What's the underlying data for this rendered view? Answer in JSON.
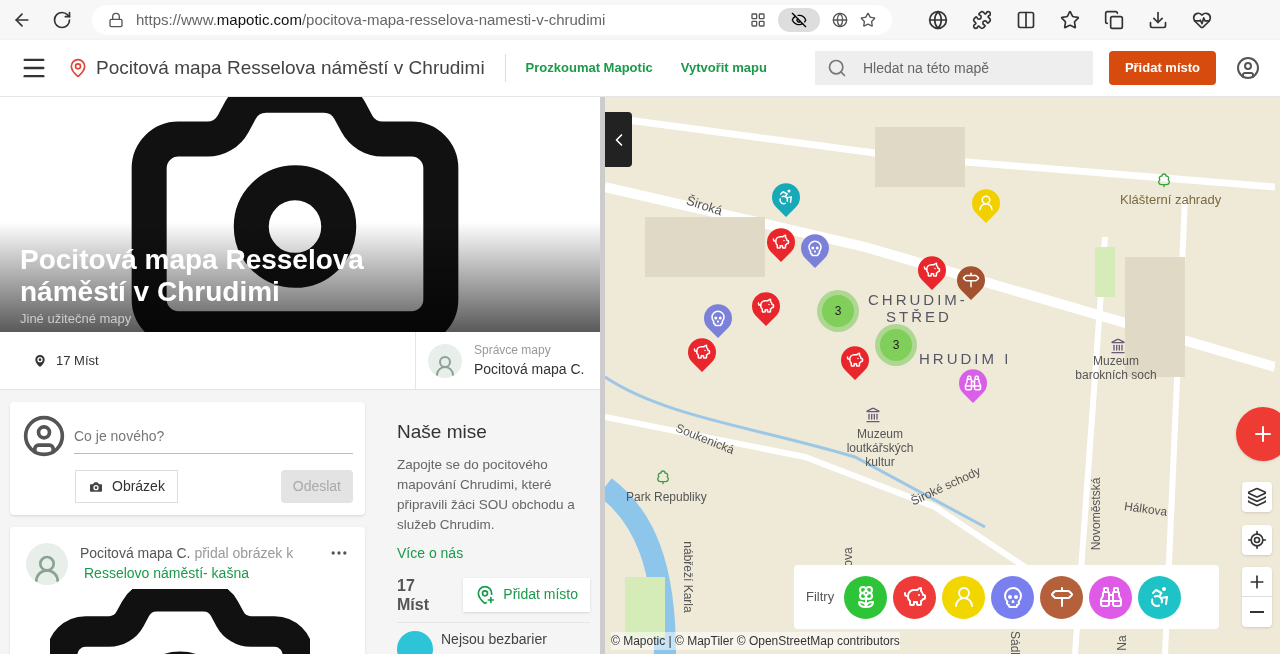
{
  "browser": {
    "url_prefix": "https://www.",
    "url_domain": "mapotic.com",
    "url_path": "/pocitova-mapa-resselova-namesti-v-chrudimi"
  },
  "header": {
    "title": "Pocitová mapa Resselova náměstí v Chrudimi",
    "links": [
      "Prozkoumat Mapotic",
      "Vytvořit mapu"
    ],
    "search": {
      "placeholder": "Hledat na této mapě"
    },
    "add_button": "Přidat místo"
  },
  "hero": {
    "title": "Pocitová mapa Resselova náměstí v Chrudimi",
    "category": "Jiné užitečné mapy"
  },
  "stats": {
    "places": "17 Míst",
    "admin_label": "Správce mapy",
    "admin_name": "Pocitová mapa C."
  },
  "composer": {
    "placeholder": "Co je nového?",
    "image_button": "Obrázek",
    "send_button": "Odeslat",
    "send_disabled": true
  },
  "post": {
    "author": "Pocitová mapa C.",
    "action": "přidal obrázek k",
    "place": "Resselovo náměstí- kašna"
  },
  "mission": {
    "title": "Naše mise",
    "text": "Zapojte se do pocitového mapování Chrudimi, které připravili žáci SOU obchodu a služeb Chrudim.",
    "more": "Více o nás",
    "count": "17",
    "count_unit": "Míst",
    "add_button": "Přidat místo",
    "next_item": "Nejsou bezbarier"
  },
  "map": {
    "labels": [
      "Široká",
      "CHRUDIM-",
      "STŘED",
      "HRUDIM I",
      "Klášterní zahrady",
      "Muzeum barokních soch",
      "Muzeum loutkářských kultur",
      "Soukenická",
      "Park Republiky",
      "Široké schody",
      "Novoměstská",
      "Hálkova",
      "nábřeží Karla",
      "ova",
      "Sádl",
      "Na"
    ],
    "pins": [
      {
        "kind": "wheelchair",
        "color": "#17a9b8"
      },
      {
        "kind": "bust",
        "color": "#f2d000"
      },
      {
        "kind": "pig",
        "color": "#e8262c"
      },
      {
        "kind": "skull",
        "color": "#7b80d8"
      },
      {
        "kind": "pig",
        "color": "#e8262c"
      },
      {
        "kind": "signpost",
        "color": "#a3512f"
      },
      {
        "kind": "pig",
        "color": "#e8262c"
      },
      {
        "kind": "skull",
        "color": "#7b80d8"
      },
      {
        "kind": "pig",
        "color": "#e8262c"
      },
      {
        "kind": "pig",
        "color": "#e8262c"
      },
      {
        "kind": "binoculars",
        "color": "#d95ee8"
      }
    ],
    "clusters": [
      "3",
      "3"
    ],
    "filters_label": "Filtry",
    "filters": [
      {
        "kind": "flower",
        "color": "#2ec437"
      },
      {
        "kind": "pig",
        "color": "#ef3a3a"
      },
      {
        "kind": "bust",
        "color": "#f2d600"
      },
      {
        "kind": "skull",
        "color": "#7a7ff0"
      },
      {
        "kind": "signpost",
        "color": "#b4603a"
      },
      {
        "kind": "binoculars",
        "color": "#e05ae8"
      },
      {
        "kind": "wheelchair",
        "color": "#1ec3c8"
      }
    ],
    "attribution": "© Mapotic | © MapTiler © OpenStreetMap contributors"
  }
}
